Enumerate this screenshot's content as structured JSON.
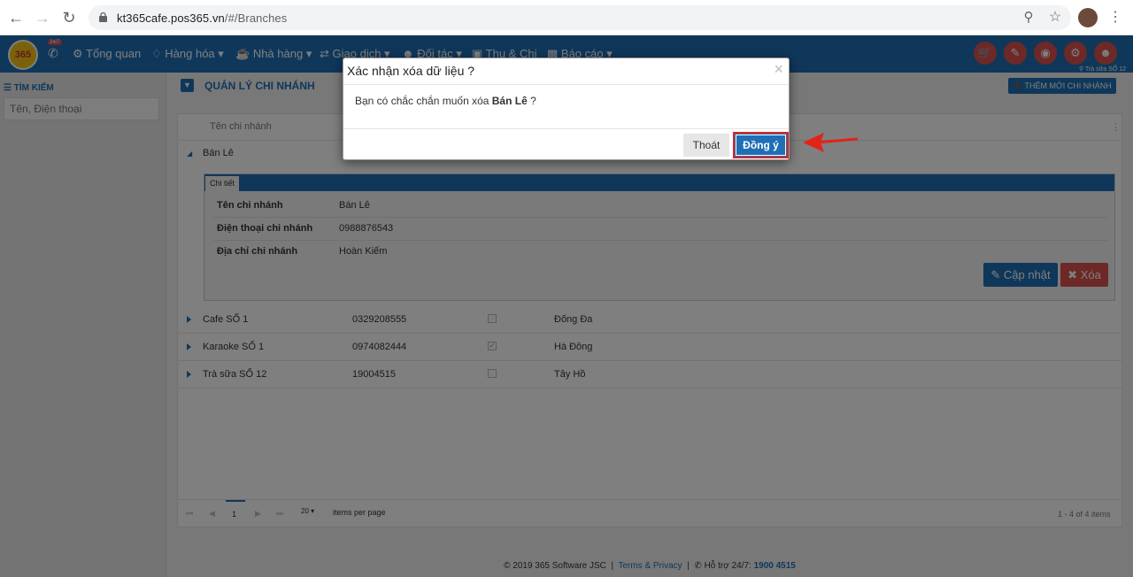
{
  "browser": {
    "url_host": "kt365cafe.pos365.vn",
    "url_path": "/#/Branches"
  },
  "nav": {
    "logo": "365",
    "hotline_badge": "24/7",
    "items": [
      "Tổng quan",
      "Hàng hóa",
      "Nhà hàng",
      "Giao dịch",
      "Đối tác",
      "Thu & Chi",
      "Báo cáo"
    ],
    "branch_label": "Trà sữa SỐ 12"
  },
  "sidebar": {
    "title": "TÌM KIẾM",
    "search_placeholder": "Tên, Điện thoại"
  },
  "page": {
    "title": "QUẢN LÝ CHI NHÁNH",
    "add_button": "THÊM MỚI CHI NHÁNH"
  },
  "grid": {
    "column_header": "Tên chi nhánh",
    "expanded_row": "Bán Lê",
    "detail_tab": "Chi tiết",
    "detail_fields": [
      {
        "label": "Tên chi nhánh",
        "value": "Bán Lê"
      },
      {
        "label": "Điện thoại chi nhánh",
        "value": "0988876543"
      },
      {
        "label": "Địa chỉ chi nhánh",
        "value": "Hoàn Kiếm"
      }
    ],
    "update_button": "Cập nhật",
    "delete_button": "Xóa",
    "rows": [
      {
        "name": "Cafe SỐ 1",
        "phone": "0329208555",
        "address": "Đống Đa",
        "checked": false
      },
      {
        "name": "Karaoke SỐ 1",
        "phone": "0974082444",
        "address": "Hà Đông",
        "checked": true
      },
      {
        "name": "Trà sữa SỐ 12",
        "phone": "19004515",
        "address": "Tây Hồ",
        "checked": false
      }
    ],
    "pager_page": "1",
    "pager_size": "20",
    "pager_label": "items per page",
    "pager_info": "1 - 4 of 4 items"
  },
  "footer": {
    "copyright": "© 2019 365 Software JSC",
    "terms": "Terms & Privacy",
    "support_label": "Hỗ trợ 24/7:",
    "support_phone": "1900 4515"
  },
  "modal": {
    "title": "Xác nhận xóa dữ liệu ?",
    "body_prefix": "Bạn có chắc chắn muốn xóa ",
    "body_target": "Bán Lê",
    "body_suffix": " ?",
    "cancel_label": "Thoát",
    "confirm_label": "Đồng ý"
  },
  "colors": {
    "primary": "#1f6fb5",
    "danger": "#d9534f",
    "highlight": "#e2231a"
  }
}
